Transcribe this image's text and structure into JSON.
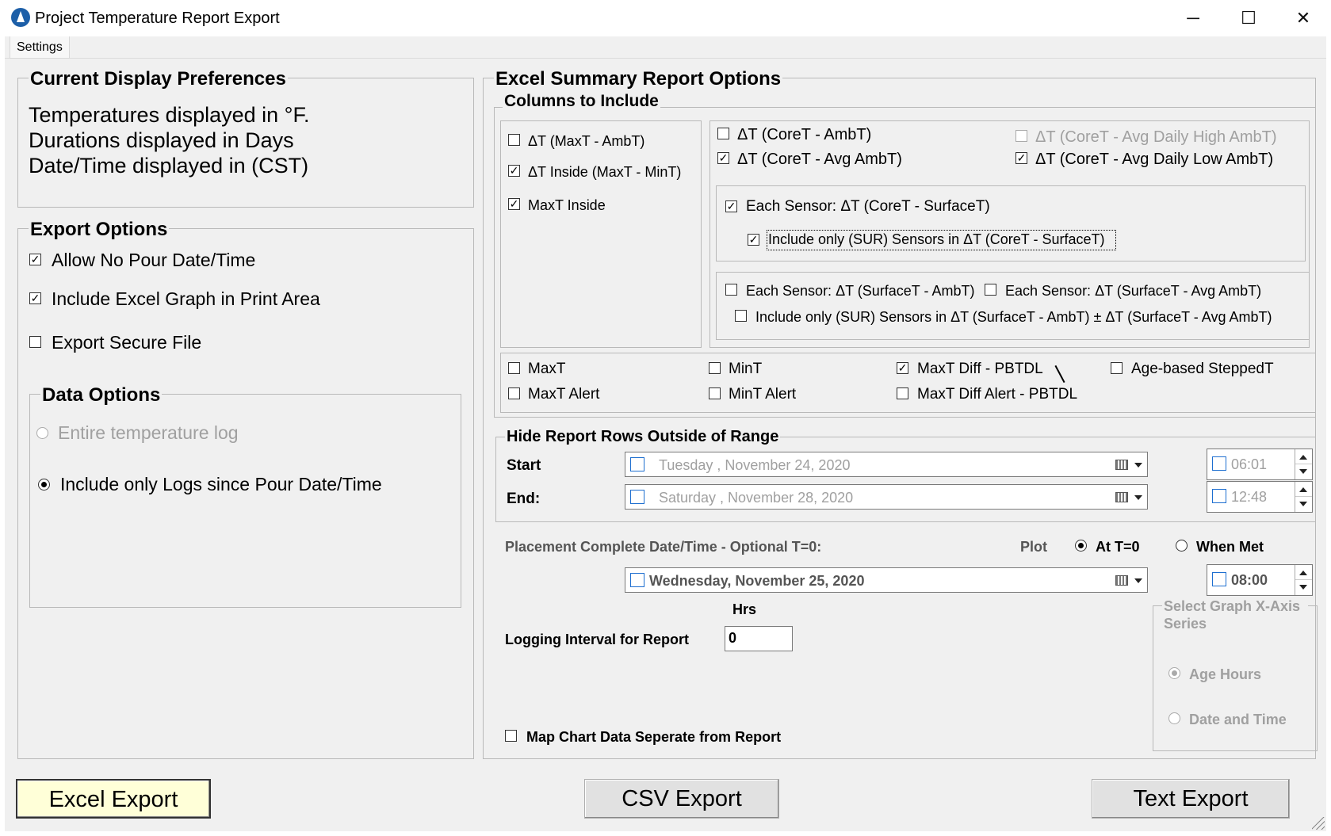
{
  "window": {
    "title": "Project Temperature Report Export",
    "controls": {
      "minimize": "─",
      "maximize": "☐",
      "close": "✕"
    }
  },
  "menu": {
    "settings": "Settings"
  },
  "display_prefs": {
    "heading": "Current Display Preferences",
    "line1": "Temperatures displayed in °F.",
    "line2": "Durations displayed in Days",
    "line3": "Date/Time displayed in (CST)"
  },
  "export_options": {
    "heading": "Export Options",
    "allow_no_pour": {
      "label": "Allow No Pour Date/Time",
      "checked": true
    },
    "include_graph": {
      "label": "Include Excel Graph in Print Area",
      "checked": true
    },
    "secure_file": {
      "label": "Export Secure File",
      "checked": false
    }
  },
  "data_options": {
    "heading": "Data Options",
    "entire_log": {
      "label": "Entire temperature log",
      "selected": false,
      "enabled": false
    },
    "since_pour": {
      "label": "Include only Logs since Pour Date/Time",
      "selected": true
    }
  },
  "excel_summary": {
    "heading": "Excel Summary Report Options",
    "columns_heading": "Columns to Include",
    "left_cols": [
      {
        "label": "ΔT (MaxT - AmbT)",
        "checked": false
      },
      {
        "label": "ΔT Inside (MaxT - MinT)",
        "checked": true
      },
      {
        "label": "MaxT Inside",
        "checked": true
      }
    ],
    "core_amb": {
      "label": "ΔT (CoreT - AmbT)",
      "checked": false
    },
    "core_avg_high": {
      "label": "ΔT (CoreT - Avg Daily High AmbT)",
      "checked": false
    },
    "core_avg_amb": {
      "label": "ΔT (CoreT - Avg AmbT)",
      "checked": true
    },
    "core_avg_low": {
      "label": "ΔT (CoreT - Avg Daily Low AmbT)",
      "checked": true
    },
    "each_core_surface": {
      "label": "Each Sensor: ΔT (CoreT - SurfaceT)",
      "checked": true
    },
    "only_sur_core_surface": {
      "label": "Include only (SUR) Sensors in ΔT (CoreT - SurfaceT)",
      "checked": true
    },
    "each_surface_amb": {
      "label": "Each Sensor: ΔT (SurfaceT - AmbT)",
      "checked": false
    },
    "each_surface_avg_amb": {
      "label": "Each Sensor: ΔT (SurfaceT - Avg AmbT)",
      "checked": false
    },
    "only_sur_surface": {
      "label": "Include only (SUR) Sensors in ΔT (SurfaceT - AmbT) ± ΔT (SurfaceT - Avg AmbT)",
      "checked": false
    },
    "maxt": {
      "label": "MaxT",
      "checked": false
    },
    "mint": {
      "label": "MinT",
      "checked": false
    },
    "maxt_diff": {
      "label": "MaxT Diff - PBTDL",
      "checked": true
    },
    "age_stepped": {
      "label": "Age-based SteppedT",
      "checked": false
    },
    "maxt_alert": {
      "label": "MaxT Alert",
      "checked": false
    },
    "mint_alert": {
      "label": "MinT Alert",
      "checked": false
    },
    "maxt_diff_alert": {
      "label": "MaxT Diff Alert - PBTDL",
      "checked": false
    }
  },
  "hide_rows": {
    "heading": "Hide Report Rows Outside of Range",
    "start_label": "Start",
    "start_date": "Tuesday   ,  November  24, 2020",
    "start_time": "06:01",
    "end_label": "End:",
    "end_date": "Saturday   ,  November  28, 2020",
    "end_time": "12:48"
  },
  "placement": {
    "label": "Placement Complete Date/Time - Optional T=0:",
    "plot_label": "Plot",
    "at_t0": {
      "label": "At T=0",
      "selected": true
    },
    "when_met": {
      "label": "When Met",
      "selected": false
    },
    "date": "Wednesday,  November  25,  2020",
    "time": "08:00"
  },
  "logging": {
    "hrs_label": "Hrs",
    "label": "Logging Interval for Report",
    "value": "0"
  },
  "map_chart": {
    "label": "Map Chart Data Seperate from Report",
    "checked": false
  },
  "x_axis": {
    "heading": "Select Graph X-Axis Series",
    "age_hours": {
      "label": "Age Hours",
      "selected": true
    },
    "date_time": {
      "label": "Date and Time",
      "selected": false
    }
  },
  "buttons": {
    "excel": "Excel Export",
    "csv": "CSV Export",
    "text": "Text Export"
  }
}
